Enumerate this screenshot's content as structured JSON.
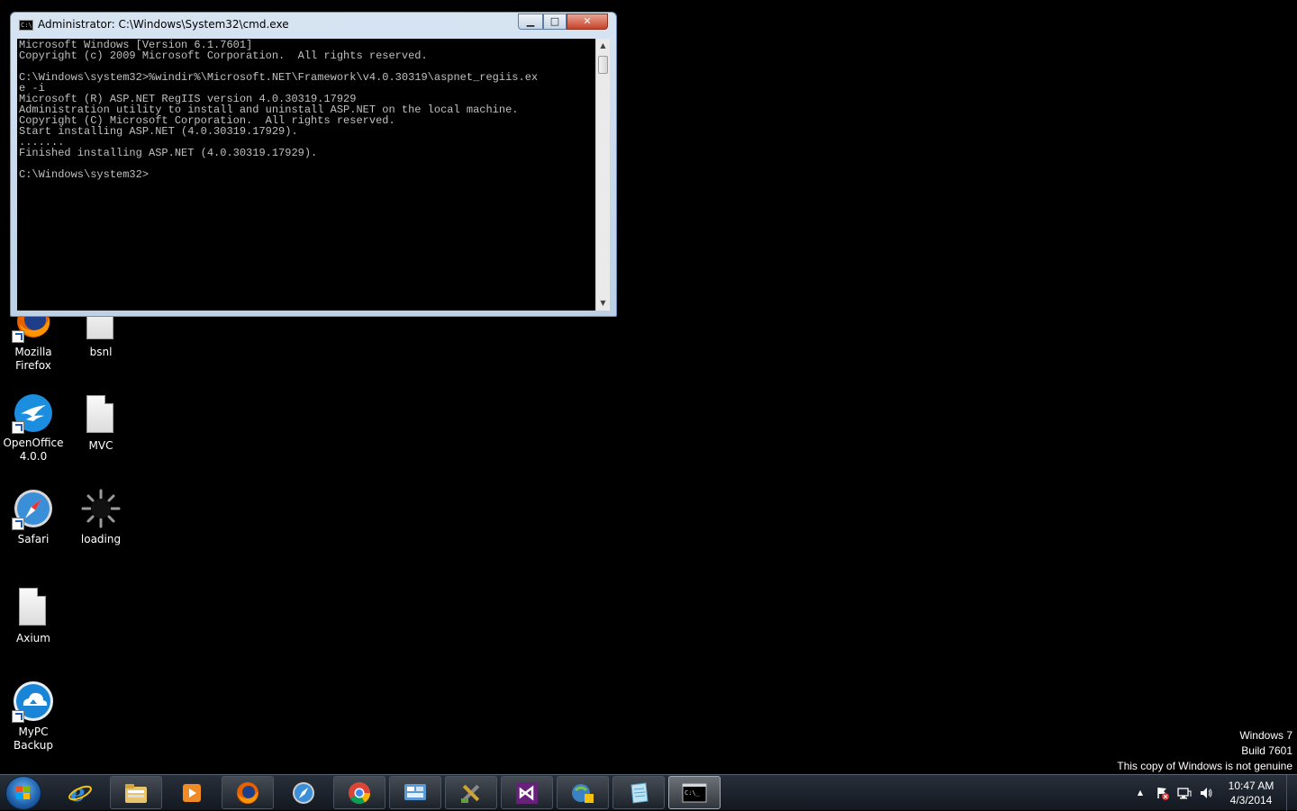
{
  "window": {
    "title": "Administrator: C:\\Windows\\System32\\cmd.exe",
    "icon_label": "C:\\.",
    "buttons": {
      "minimize": "▁",
      "maximize": "□",
      "close": "✕"
    },
    "console_text": "Microsoft Windows [Version 6.1.7601]\nCopyright (c) 2009 Microsoft Corporation.  All rights reserved.\n\nC:\\Windows\\system32>%windir%\\Microsoft.NET\\Framework\\v4.0.30319\\aspnet_regiis.ex\ne -i\nMicrosoft (R) ASP.NET RegIIS version 4.0.30319.17929\nAdministration utility to install and uninstall ASP.NET on the local machine.\nCopyright (C) Microsoft Corporation.  All rights reserved.\nStart installing ASP.NET (4.0.30319.17929).\n.......\nFinished installing ASP.NET (4.0.30319.17929).\n\nC:\\Windows\\system32>"
  },
  "desktop_icons": [
    {
      "label": "Mozilla Firefox",
      "icon": "firefox-icon",
      "shortcut": true
    },
    {
      "label": "bsnl",
      "icon": "document-icon",
      "shortcut": false
    },
    {
      "label": "OpenOffice 4.0.0",
      "icon": "openoffice-icon",
      "shortcut": true
    },
    {
      "label": "MVC",
      "icon": "document-icon",
      "shortcut": false
    },
    {
      "label": "Safari",
      "icon": "safari-icon",
      "shortcut": true
    },
    {
      "label": "loading",
      "icon": "loading-icon",
      "shortcut": false
    },
    {
      "label": "Axium",
      "icon": "document-icon",
      "shortcut": false
    },
    {
      "label": "MyPC Backup",
      "icon": "mypc-backup-icon",
      "shortcut": true
    }
  ],
  "watermark": {
    "line1": "Windows 7",
    "line2": "Build 7601",
    "line3": "This copy of Windows is not genuine"
  },
  "taskbar": {
    "start": "windows-start-icon",
    "pinned": [
      "internet-explorer-icon",
      "windows-explorer-icon",
      "media-player-icon",
      "firefox-icon",
      "safari-icon",
      "chrome-icon",
      "control-panel-icon",
      "tools-icon",
      "visual-studio-icon",
      "windows-update-icon",
      "notepad-icon",
      "cmd-icon"
    ],
    "active_app": "cmd-icon",
    "cmd_icon_label": "C:\\_"
  },
  "tray": {
    "show_hidden": "▲",
    "icons": [
      "action-center-icon",
      "network-icon",
      "volume-icon"
    ],
    "time": "10:47 AM",
    "date": "4/3/2014"
  },
  "colors": {
    "desktop": "#000000",
    "console_bg": "#000000",
    "console_fg": "#c0c0c0",
    "window_frame": "#c9d9ec",
    "close_button": "#c7432a"
  }
}
